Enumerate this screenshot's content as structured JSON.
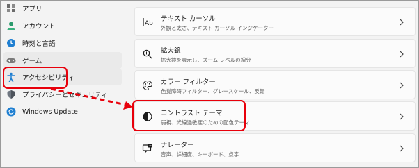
{
  "sidebar": {
    "items": [
      {
        "label": "アプリ",
        "icon": "apps-icon"
      },
      {
        "label": "アカウント",
        "icon": "account-icon"
      },
      {
        "label": "時刻と言語",
        "icon": "time-language-icon"
      },
      {
        "label": "ゲーム",
        "icon": "gaming-icon"
      },
      {
        "label": "アクセシビリティ",
        "icon": "accessibility-icon"
      },
      {
        "label": "プライバシーとセキュリティ",
        "icon": "shield-icon"
      },
      {
        "label": "Windows Update",
        "icon": "windows-update-icon"
      }
    ]
  },
  "settings": [
    {
      "title": "テキスト カーソル",
      "subtitle": "外観と太さ、テキスト カーソル インジケーター",
      "icon": "text-cursor-icon"
    },
    {
      "title": "拡大鏡",
      "subtitle": "拡大鏡を表示し、ズーム レベルの増分",
      "icon": "magnifier-icon"
    },
    {
      "title": "カラー フィルター",
      "subtitle": "色覚障碍フィルター、グレースケール、反転",
      "icon": "color-filter-icon"
    },
    {
      "title": "コントラスト テーマ",
      "subtitle": "弱視、光線過敏症のための配色テーマ",
      "icon": "contrast-theme-icon"
    },
    {
      "title": "ナレーター",
      "subtitle": "音声、詳細度、キーボード、点字",
      "icon": "narrator-icon"
    }
  ],
  "annotations": {
    "highlight_color": "#e8000b"
  }
}
